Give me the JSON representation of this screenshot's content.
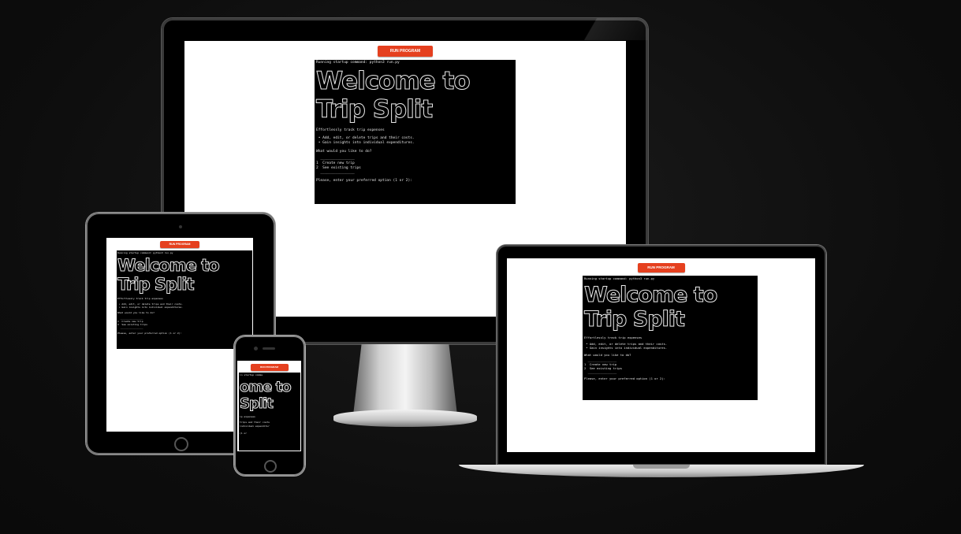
{
  "app": {
    "run_button": "RUN PROGRAM",
    "startup": "Running startup command: python3 run.py",
    "banner_line1": "Welcome to",
    "banner_line2": "Trip Split",
    "intro": "Effortlessly track trip expenses",
    "bullet1": " • Add, edit, or delete trips and their costs.",
    "bullet2": " • Gain insights into individual expenditures.",
    "question": "What would you like to do?",
    "rule": "  ________________",
    "option1": "1  Create new trip",
    "option2": "2  See existing trips",
    "prompt": "Please, enter your preferred option (1 or 2):"
  },
  "phone": {
    "startup": "in startup comma",
    "banner_line1": "ome to",
    "banner_line2": "Split",
    "intro": "ip expenses",
    "bullet1": "trips and their costs",
    "bullet2": "individual expenditur",
    "prompt": "(1 or"
  },
  "colors": {
    "accent": "#e5401f",
    "terminal_bg": "#000000",
    "frame": "#000000",
    "screen": "#ffffff"
  }
}
